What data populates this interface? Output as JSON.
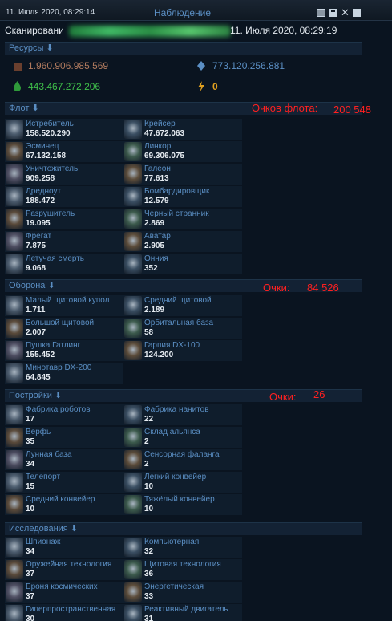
{
  "titlebar": {
    "date": "11. Июля 2020, 08:29:14",
    "title": "Наблюдение"
  },
  "scan": {
    "label": "Сканировани",
    "time": "11. Июля 2020, 08:29:19"
  },
  "resources": {
    "header": "Ресурсы ⬇",
    "metal": "1.960.906.985.569",
    "crystal": "773.120.256.881",
    "deuterium": "443.467.272.206",
    "energy": "0",
    "colors": {
      "metal": "#b07a5e",
      "crystal": "#5b8fc4",
      "deuterium": "#3fbf4a",
      "energy": "#e0a020"
    }
  },
  "fleet": {
    "header": "Флот ⬇",
    "note_label": "Очков флота:",
    "note_value": "200 548",
    "items": [
      {
        "name": "Истребитель",
        "count": "158.520.290",
        "icon": "fighter-icon"
      },
      {
        "name": "Крейсер",
        "count": "47.672.063",
        "icon": "cruiser-icon"
      },
      {
        "name": "Эсминец",
        "count": "67.132.158",
        "icon": "destroyer-icon"
      },
      {
        "name": "Линкор",
        "count": "69.306.075",
        "icon": "battleship-icon"
      },
      {
        "name": "Уничтожитель",
        "count": "909.258",
        "icon": "annihilator-icon"
      },
      {
        "name": "Галеон",
        "count": "77.613",
        "icon": "galleon-icon"
      },
      {
        "name": "Дредноут",
        "count": "188.472",
        "icon": "dreadnought-icon"
      },
      {
        "name": "Бомбардировщик",
        "count": "12.579",
        "icon": "bomber-icon"
      },
      {
        "name": "Разрушитель",
        "count": "19.095",
        "icon": "destroyer2-icon"
      },
      {
        "name": "Черный странник",
        "count": "2.869",
        "icon": "black-wanderer-icon"
      },
      {
        "name": "Фрегат",
        "count": "7.875",
        "icon": "frigate-icon"
      },
      {
        "name": "Аватар",
        "count": "2.905",
        "icon": "avatar-icon"
      },
      {
        "name": "Летучая смерть",
        "count": "9.068",
        "icon": "flying-death-icon"
      },
      {
        "name": "Онния",
        "count": "352",
        "icon": "onnia-icon"
      }
    ]
  },
  "defense": {
    "header": "Оборона ⬇",
    "note_label": "Очки:",
    "note_value": "84 526",
    "items": [
      {
        "name": "Малый щитовой купол",
        "count": "1.711",
        "icon": "small-shield-icon"
      },
      {
        "name": "Средний щитовой",
        "count": "2.189",
        "icon": "medium-shield-icon"
      },
      {
        "name": "Большой щитовой",
        "count": "2.007",
        "icon": "large-shield-icon"
      },
      {
        "name": "Орбитальная база",
        "count": "58",
        "icon": "orbital-base-icon"
      },
      {
        "name": "Пушка Гатлинг",
        "count": "155.452",
        "icon": "gatling-icon"
      },
      {
        "name": "Гарпия DX-100",
        "count": "124.200",
        "icon": "harpy-icon"
      },
      {
        "name": "Минотавр DX-200",
        "count": "64.845",
        "icon": "minotaur-icon"
      }
    ]
  },
  "buildings": {
    "header": "Постройки ⬇",
    "note_label": "Очки:",
    "note_value": "26",
    "items": [
      {
        "name": "Фабрика роботов",
        "count": "17",
        "icon": "robot-factory-icon"
      },
      {
        "name": "Фабрика нанитов",
        "count": "22",
        "icon": "nanite-factory-icon"
      },
      {
        "name": "Верфь",
        "count": "35",
        "icon": "shipyard-icon"
      },
      {
        "name": "Склад альянса",
        "count": "2",
        "icon": "alliance-depot-icon"
      },
      {
        "name": "Лунная база",
        "count": "34",
        "icon": "lunar-base-icon"
      },
      {
        "name": "Сенсорная фаланга",
        "count": "2",
        "icon": "sensor-phalanx-icon"
      },
      {
        "name": "Телепорт",
        "count": "15",
        "icon": "teleport-icon"
      },
      {
        "name": "Легкий конвейер",
        "count": "10",
        "icon": "light-conveyor-icon"
      },
      {
        "name": "Средний конвейер",
        "count": "10",
        "icon": "medium-conveyor-icon"
      },
      {
        "name": "Тяжёлый конвейер",
        "count": "10",
        "icon": "heavy-conveyor-icon"
      }
    ]
  },
  "research": {
    "header": "Исследования ⬇",
    "items": [
      {
        "name": "Шпионаж",
        "count": "34",
        "icon": "espionage-icon"
      },
      {
        "name": "Компьютерная",
        "count": "32",
        "icon": "computer-icon"
      },
      {
        "name": "Оружейная технология",
        "count": "37",
        "icon": "weapons-icon"
      },
      {
        "name": "Щитовая технология",
        "count": "36",
        "icon": "shielding-icon"
      },
      {
        "name": "Броня космических",
        "count": "37",
        "icon": "armour-icon"
      },
      {
        "name": "Энергетическая",
        "count": "33",
        "icon": "energy-tech-icon"
      },
      {
        "name": "Гиперпространственная",
        "count": "30",
        "icon": "hyperspace-icon"
      },
      {
        "name": "Реактивный двигатель",
        "count": "31",
        "icon": "combustion-drive-icon"
      }
    ]
  }
}
